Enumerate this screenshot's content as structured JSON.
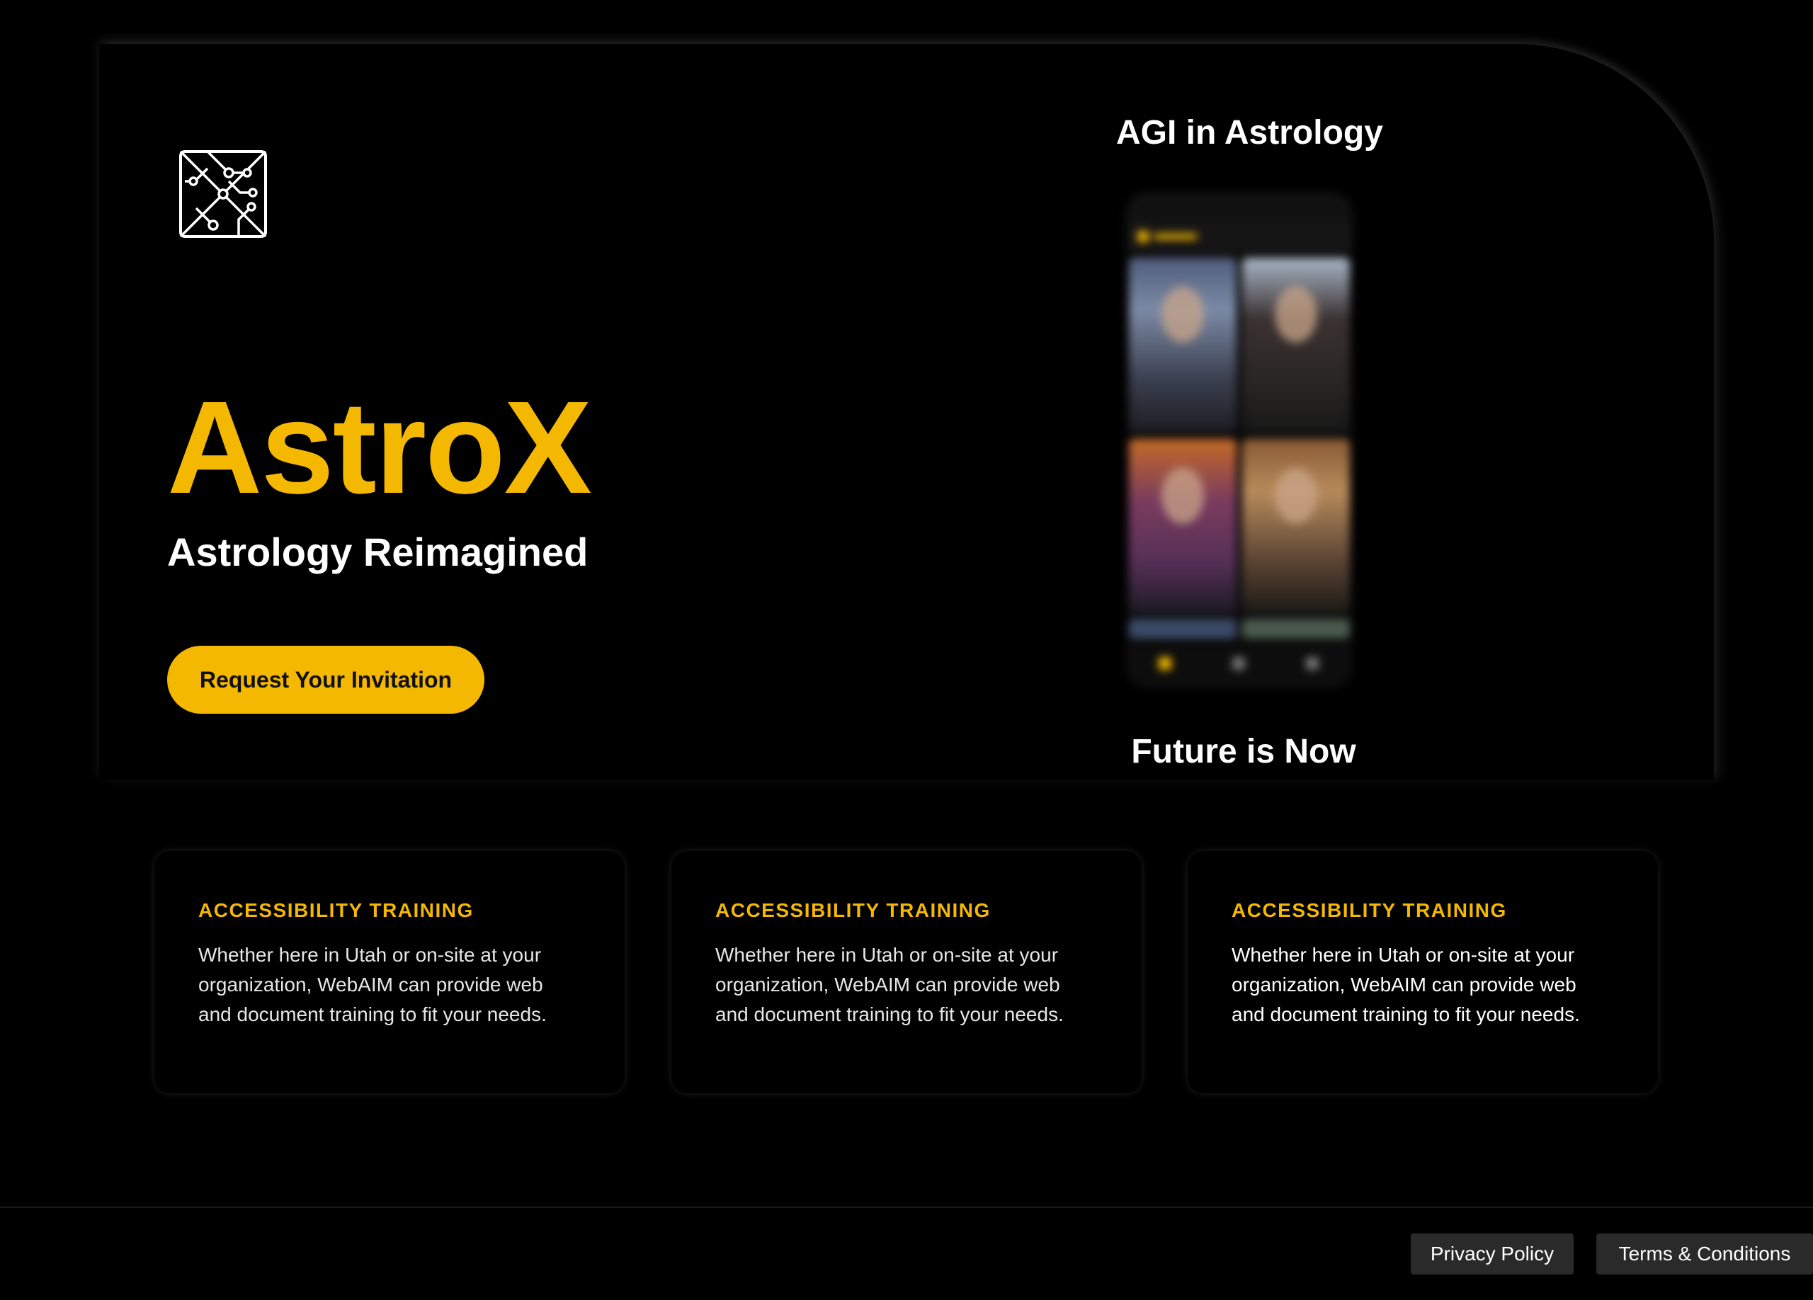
{
  "hero": {
    "logo_icon": "circuit-grid-logo-icon",
    "brand": "AstroX",
    "tagline": "Astrology Reimagined",
    "cta_label": "Request Your Invitation"
  },
  "promo": {
    "top_text": "AGI in Astrology",
    "bottom_text": "Future is Now",
    "phone_image": "blurred-app-screenshot"
  },
  "cards": [
    {
      "title": "ACCESSIBILITY TRAINING",
      "body": "Whether here in Utah or on-site at your organization, WebAIM can provide web and document training to fit your needs."
    },
    {
      "title": "ACCESSIBILITY TRAINING",
      "body": "Whether here in Utah or on-site at your organization, WebAIM can provide web and document training to fit your needs."
    },
    {
      "title": "ACCESSIBILITY TRAINING",
      "body": "Whether here in Utah or on-site at your organization, WebAIM can provide web and document training to fit your needs."
    }
  ],
  "footer": {
    "privacy_label": "Privacy Policy",
    "terms_label": "Terms & Conditions"
  },
  "colors": {
    "accent": "#f5b800",
    "background": "#000000",
    "footer_button": "#2a2a2a"
  }
}
